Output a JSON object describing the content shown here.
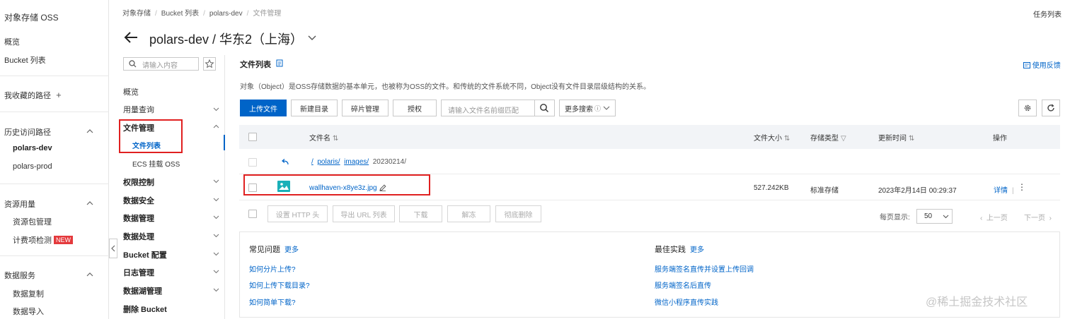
{
  "global_nav": {
    "title": "对象存储 OSS",
    "overview": "概览",
    "bucket_list": "Bucket 列表",
    "favorites": "我收藏的路径",
    "history_title": "历史访问路径",
    "history_items": [
      "polars-dev",
      "polars-prod"
    ],
    "resources_title": "资源用量",
    "resources_items": [
      "资源包管理",
      "计费项检测"
    ],
    "new_badge": "NEW",
    "data_service_title": "数据服务",
    "data_service_items": [
      "数据复制",
      "数据导入"
    ]
  },
  "header": {
    "breadcrumb": [
      "对象存储",
      "Bucket 列表",
      "polars-dev",
      "文件管理"
    ],
    "task_list": "任务列表",
    "title": "polars-dev / 华东2（上海）"
  },
  "bucket_menu": {
    "search_placeholder": "请输入内容",
    "items": [
      "概览",
      "用量查询",
      "文件管理",
      "文件列表",
      "ECS 挂载 OSS",
      "权限控制",
      "数据安全",
      "数据管理",
      "数据处理",
      "Bucket 配置",
      "日志管理",
      "数据湖管理",
      "删除 Bucket"
    ]
  },
  "main": {
    "title": "文件列表",
    "feedback": "使用反馈",
    "description": "对象（Object）是OSS存储数据的基本单元，也被称为OSS的文件。和传统的文件系统不同，Object没有文件目录层级结构的关系。",
    "toolbar": {
      "upload": "上传文件",
      "new_dir": "新建目录",
      "fragments": "碎片管理",
      "authorize": "授权",
      "search_placeholder": "请输入文件名前缀匹配",
      "more_search": "更多搜索"
    },
    "table": {
      "headers": [
        "文件名",
        "文件大小",
        "存储类型",
        "更新时间",
        "操作"
      ],
      "path": {
        "root": "/",
        "seg1": "polaris/",
        "seg2": "images/",
        "seg3": "20230214/"
      },
      "rows": [
        {
          "name": "wallhaven-x8ye3z.jpg",
          "size": "527.242KB",
          "storage": "标准存储",
          "updated": "2023年2月14日 00:29:37",
          "action": "详情"
        }
      ]
    },
    "bulk": [
      "设置 HTTP 头",
      "导出 URL 列表",
      "下载",
      "解冻",
      "彻底删除"
    ],
    "pagination": {
      "per_page_label": "每页显示:",
      "per_page": "50",
      "prev": "上一页",
      "next": "下一页"
    }
  },
  "faq": {
    "left_title": "常见问题",
    "left_more": "更多",
    "left_links": [
      "如何分片上传?",
      "如何上传下载目录?",
      "如何简单下载?"
    ],
    "right_title": "最佳实践",
    "right_more": "更多",
    "right_links": [
      "服务端签名直传并设置上传回调",
      "服务端签名后直传",
      "微信小程序直传实践"
    ]
  },
  "watermark": "@稀土掘金技术社区"
}
